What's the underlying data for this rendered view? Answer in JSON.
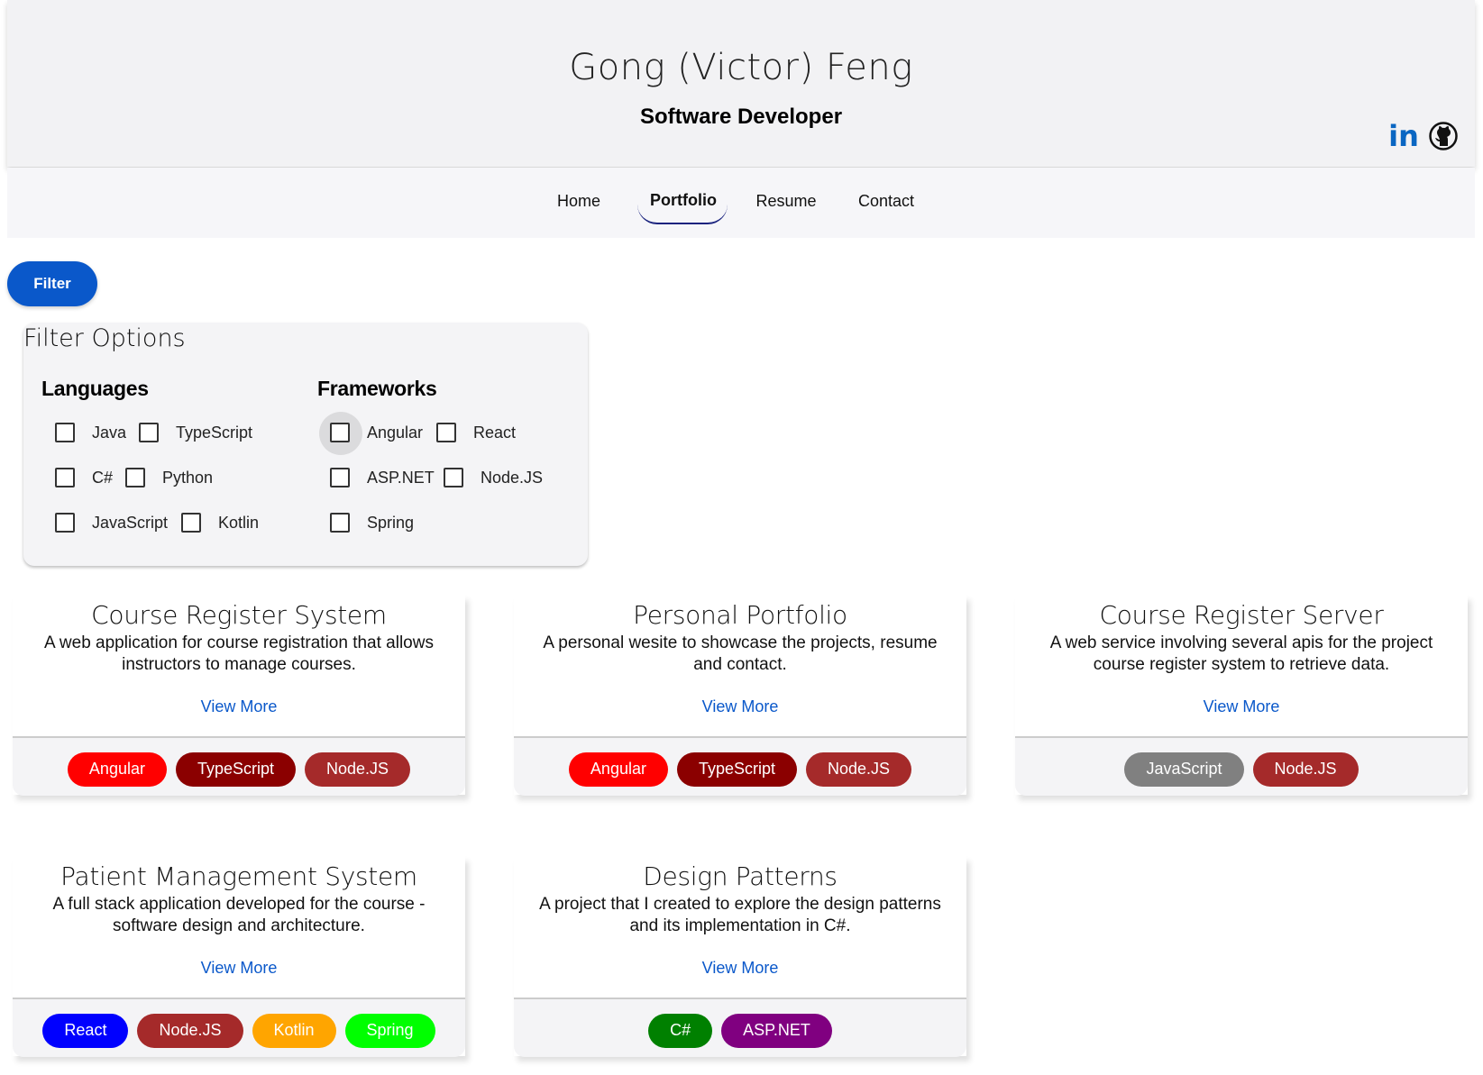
{
  "header": {
    "name": "Gong (Victor) Feng",
    "role": "Software Developer",
    "linkedin_icon_text": "in"
  },
  "nav": {
    "items": [
      {
        "label": "Home"
      },
      {
        "label": "Portfolio",
        "active": true
      },
      {
        "label": "Resume"
      },
      {
        "label": "Contact"
      }
    ]
  },
  "filter": {
    "button_label": "Filter",
    "panel_title": "Filter Options",
    "languages_title": "Languages",
    "frameworks_title": "Frameworks",
    "languages": [
      "Java",
      "TypeScript",
      "C#",
      "Python",
      "JavaScript",
      "Kotlin"
    ],
    "frameworks": [
      "Angular",
      "React",
      "ASP.NET",
      "Node.JS",
      "Spring"
    ]
  },
  "projects": [
    {
      "title": "Course Register System",
      "description": "A web application for course registration that allows instructors to manage courses.",
      "link": "View More",
      "tags": [
        {
          "label": "Angular",
          "color": "#ff0000"
        },
        {
          "label": "TypeScript",
          "color": "#8b0000"
        },
        {
          "label": "Node.JS",
          "color": "#a52a2a"
        }
      ]
    },
    {
      "title": "Personal Portfolio",
      "description": "A personal wesite to showcase the projects, resume and contact.",
      "link": "View More",
      "tags": [
        {
          "label": "Angular",
          "color": "#ff0000"
        },
        {
          "label": "TypeScript",
          "color": "#8b0000"
        },
        {
          "label": "Node.JS",
          "color": "#a52a2a"
        }
      ]
    },
    {
      "title": "Course Register Server",
      "description": "A web service involving several apis for the project course register system to retrieve data.",
      "link": "View More",
      "tags": [
        {
          "label": "JavaScript",
          "color": "#808080"
        },
        {
          "label": "Node.JS",
          "color": "#a52a2a"
        }
      ]
    },
    {
      "title": "Patient Management System",
      "description": "A full stack application developed for the course - software design and architecture.",
      "link": "View More",
      "tags": [
        {
          "label": "React",
          "color": "#0000ff"
        },
        {
          "label": "Node.JS",
          "color": "#a52a2a"
        },
        {
          "label": "Kotlin",
          "color": "#ffa500"
        },
        {
          "label": "Spring",
          "color": "#00ff00"
        }
      ]
    },
    {
      "title": "Design Patterns",
      "description": "A project that I created to explore the design patterns and its implementation in C#.",
      "link": "View More",
      "tags": [
        {
          "label": "C#",
          "color": "#008000"
        },
        {
          "label": "ASP.NET",
          "color": "#800080"
        }
      ]
    }
  ]
}
